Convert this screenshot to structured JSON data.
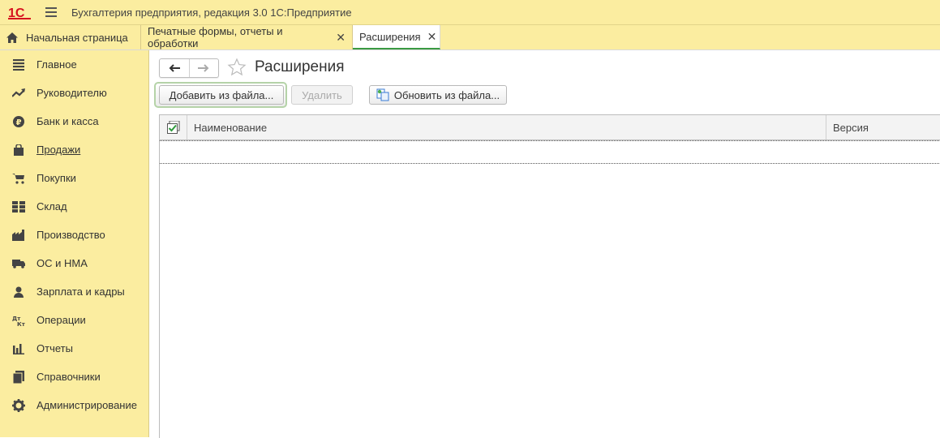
{
  "app": {
    "title": "Бухгалтерия предприятия, редакция 3.0 1С:Предприятие"
  },
  "tabs": [
    {
      "label": "Начальная страница",
      "icon": "home-icon"
    },
    {
      "label": "Печатные формы, отчеты и обработки",
      "closable": true
    },
    {
      "label": "Расширения",
      "closable": true,
      "active": true
    }
  ],
  "sidebar": {
    "items": [
      {
        "label": "Главное",
        "icon": "list-icon"
      },
      {
        "label": "Руководителю",
        "icon": "trend-icon"
      },
      {
        "label": "Банк и касса",
        "icon": "ruble-icon"
      },
      {
        "label": "Продажи",
        "icon": "bag-icon",
        "underlined": true
      },
      {
        "label": "Покупки",
        "icon": "cart-icon"
      },
      {
        "label": "Склад",
        "icon": "warehouse-icon"
      },
      {
        "label": "Производство",
        "icon": "factory-icon"
      },
      {
        "label": "ОС и НМА",
        "icon": "truck-icon"
      },
      {
        "label": "Зарплата и кадры",
        "icon": "person-icon"
      },
      {
        "label": "Операции",
        "icon": "dt-kt-icon"
      },
      {
        "label": "Отчеты",
        "icon": "bar-chart-icon"
      },
      {
        "label": "Справочники",
        "icon": "books-icon"
      },
      {
        "label": "Администрирование",
        "icon": "gear-icon"
      }
    ]
  },
  "page": {
    "title": "Расширения"
  },
  "toolbar": {
    "add_label": "Добавить из файла...",
    "delete_label": "Удалить",
    "update_label": "Обновить из файла..."
  },
  "grid": {
    "columns": [
      "Наименование",
      "Версия"
    ]
  },
  "colors": {
    "panel": "#fbeda0",
    "accent_green": "#3a9a43",
    "logo_red": "#d6121f"
  }
}
